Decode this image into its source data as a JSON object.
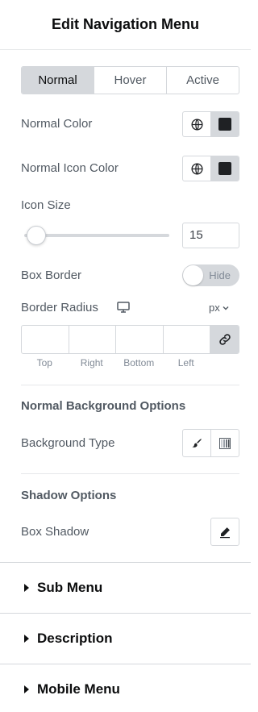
{
  "header": {
    "title": "Edit Navigation Menu"
  },
  "state_tabs": [
    {
      "label": "Normal",
      "active": true
    },
    {
      "label": "Hover",
      "active": false
    },
    {
      "label": "Active",
      "active": false
    }
  ],
  "normal_color": {
    "label": "Normal Color",
    "swatch": "#1f2124"
  },
  "normal_icon_color": {
    "label": "Normal Icon Color",
    "swatch": "#1f2124"
  },
  "icon_size": {
    "label": "Icon Size",
    "value": "15"
  },
  "box_border": {
    "label": "Box Border",
    "toggle_text": "Hide",
    "enabled": false
  },
  "border_radius": {
    "label": "Border Radius",
    "unit": "px",
    "fields": [
      "Top",
      "Right",
      "Bottom",
      "Left"
    ],
    "values": [
      "",
      "",
      "",
      ""
    ]
  },
  "background_section": {
    "heading": "Normal Background Options",
    "type_label": "Background Type"
  },
  "shadow_section": {
    "heading": "Shadow Options",
    "box_shadow_label": "Box Shadow"
  },
  "accordions": [
    "Sub Menu",
    "Description",
    "Mobile Menu"
  ],
  "icons": {
    "globe": "globe-icon",
    "monitor": "monitor-icon",
    "link": "link-icon",
    "brush": "brush-icon",
    "gradient": "gradient-icon",
    "pencil": "pencil-icon",
    "caret": "caret-right-icon",
    "chevron": "chevron-down-icon"
  },
  "colors": {
    "active_tab_bg": "#d5d8dc",
    "text": "#515962",
    "heading": "#0c0d0e"
  }
}
